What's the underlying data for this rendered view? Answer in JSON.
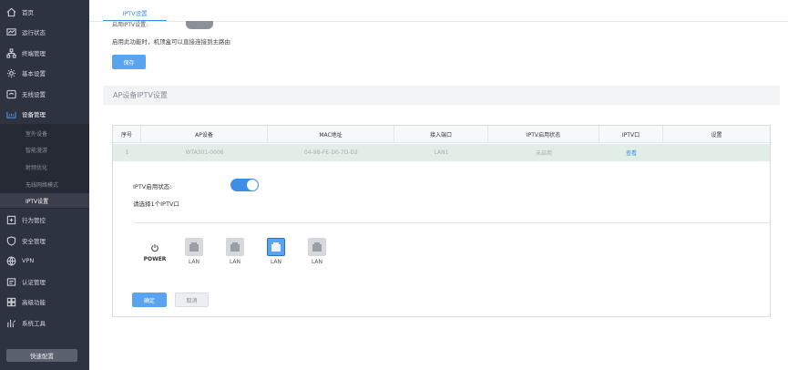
{
  "sidebar": {
    "items": [
      {
        "label": "首页",
        "icon": "home-icon"
      },
      {
        "label": "运行状态",
        "icon": "monitor-icon"
      },
      {
        "label": "终端管理",
        "icon": "terminal-tree-icon"
      },
      {
        "label": "基本设置",
        "icon": "gear-icon"
      },
      {
        "label": "无线设置",
        "icon": "wireless-icon"
      },
      {
        "label": "设备管理",
        "icon": "device-icon"
      },
      {
        "label": "行为管控",
        "icon": "behavior-icon"
      },
      {
        "label": "安全管理",
        "icon": "shield-icon"
      },
      {
        "label": "VPN",
        "icon": "globe-icon"
      },
      {
        "label": "认证管理",
        "icon": "auth-icon"
      },
      {
        "label": "高级功能",
        "icon": "advanced-icon"
      },
      {
        "label": "系统工具",
        "icon": "tools-icon"
      }
    ],
    "sub_items": [
      "室外设备",
      "智能漫游",
      "射频优化",
      "无线网络模式",
      "IPTV设置"
    ],
    "quick_config": "快速配置"
  },
  "main": {
    "tab": "IPTV设置",
    "top_label": "启用IPTV设置:",
    "hint": "启用此功能时，机顶盒可以直接连接到主路由",
    "save": "保存",
    "section_title": "AP设备IPTV设置",
    "table": {
      "headers": [
        "序号",
        "AP设备",
        "MAC地址",
        "接入端口",
        "IPTV启用状态",
        "IPTV口",
        "设置"
      ],
      "row": [
        "1",
        "WTA301-0006",
        "04-9B-FE-D0-7D-D2",
        "LAN1",
        "未启用",
        "查看",
        ""
      ]
    },
    "detail": {
      "status_label": "IPTV启用状态:",
      "select_label": "请选择1个IPTV口",
      "power_label": "POWER",
      "ports": [
        "LAN",
        "LAN",
        "LAN",
        "LAN"
      ],
      "selected_port": 2,
      "ok": "确定",
      "cancel": "取消"
    }
  },
  "colors": {
    "accent": "#3b8fe6",
    "sidebar": "#2e3340",
    "row_highlight": "#e3ede7"
  }
}
